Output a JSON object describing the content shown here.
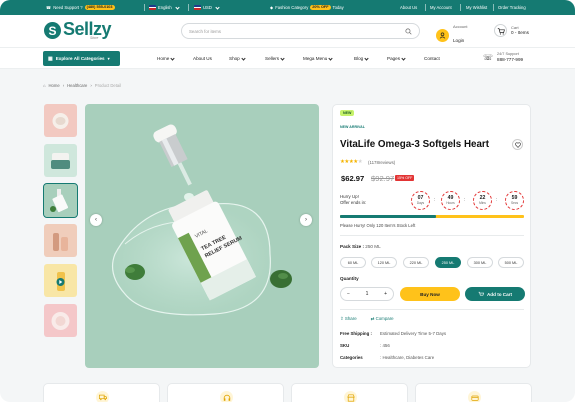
{
  "topbar": {
    "support_label": "Need Support ?",
    "support_phone": "(480) 555-0103",
    "language": "English",
    "currency": "USD",
    "promo_prefix": "Fashion Category",
    "promo_badge": "20% OFF",
    "promo_suffix": "Today",
    "links": [
      "About Us",
      "My Account",
      "My Wishlist",
      "Order Tracking"
    ]
  },
  "header": {
    "logo": "Sellzy",
    "logo_sub": "Store",
    "search_placeholder": "Search for items",
    "account_label": "Account",
    "account_action": "Login",
    "cart_label": "Cart",
    "cart_items": "0 - Items"
  },
  "nav": {
    "all_categories": "Explore All Categories",
    "items": [
      "Home",
      "About Us",
      "Shop",
      "Sellers",
      "Mega Menu",
      "Blog",
      "Pages",
      "Contact"
    ],
    "support_label": "24/7 Support",
    "support_phone": "888-777-999"
  },
  "breadcrumb": {
    "home": "Home",
    "category": "Healthcare",
    "current": "Product Detail"
  },
  "product": {
    "badge": "NEW",
    "tag": "NEW ARRIVAL",
    "title": "VitaLife Omega-3 Softgels Heart",
    "rating": 4,
    "reviews": "(1178reviews)",
    "price": "$62.97",
    "old_price": "$92.97",
    "discount": "15% OFF",
    "hurry_line1": "Hurry Up!",
    "hurry_line2": "Offer ends in:",
    "timer": [
      {
        "value": "07",
        "label": "Days"
      },
      {
        "value": "49",
        "label": "Hours"
      },
      {
        "value": "22",
        "label": "Mins"
      },
      {
        "value": "59",
        "label": "Secs"
      }
    ],
    "stock_progress": 0.52,
    "stock_text": "Please Hurry! Only 120 Item's Stock Left",
    "pack_label": "Pack Size :",
    "pack_value": "250 ML",
    "packs": [
      "60 ML",
      "120 ML",
      "220 ML",
      "250 ML",
      "300 ML",
      "500 ML"
    ],
    "selected_pack": 3,
    "qty_label": "Quantity",
    "qty": "1",
    "qty_minus": "−",
    "qty_plus": "+",
    "buy_now": "Buy Now",
    "add_to_cart": "Add to Cart",
    "share": "Share",
    "compare": "Compare",
    "info": [
      {
        "k": "Free Shipping :",
        "v": "Estimated Delivery Time 5-7 Days"
      },
      {
        "k": "SKU",
        "v": ": 456"
      },
      {
        "k": "Categories",
        "v": ": Healthcare, Diabetes Care"
      }
    ]
  },
  "image_label": {
    "line1": "TEA TREE",
    "line2": "RELIEF SERUM",
    "brand": "VITAL"
  },
  "colors": {
    "primary": "#157a72",
    "accent": "#ffc21a",
    "sale": "#e23434"
  }
}
